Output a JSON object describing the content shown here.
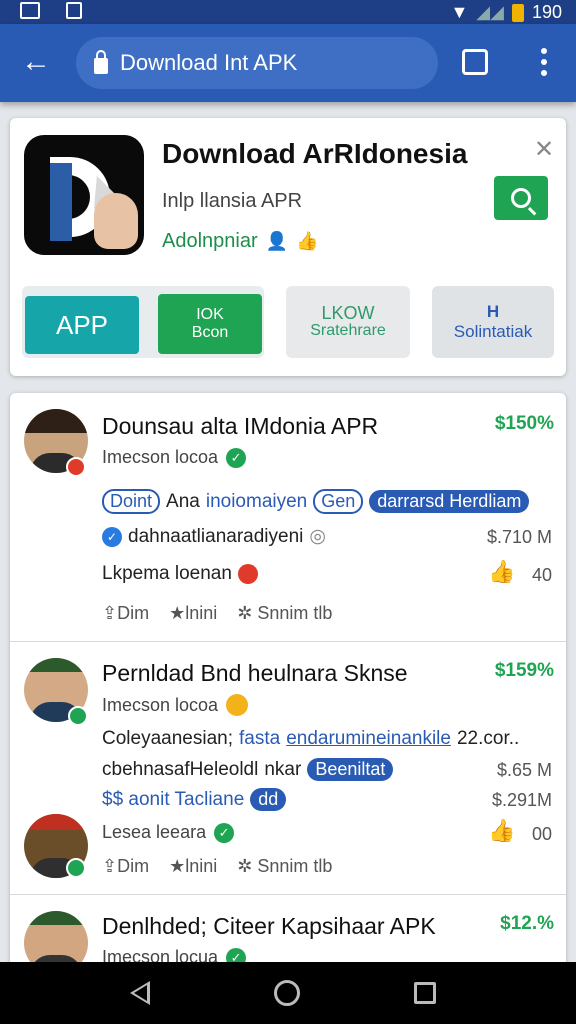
{
  "status_bar": {
    "time": "190",
    "icons": [
      "image-icon",
      "file-icon",
      "wifi-icon",
      "signal-icon",
      "battery-icon"
    ],
    "battery_color": "#f0b400"
  },
  "browser": {
    "url": "Download Int APK",
    "back_icon": "back-arrow-icon",
    "tabs_icon": "tabs-icon",
    "menu_icon": "more-vert-icon"
  },
  "hero": {
    "title": "Download ArRIdonesia",
    "subtitle": "Inlp llansia APR",
    "developer": "Adolnpniar",
    "buttons": {
      "app": "APP",
      "iok_line1": "IOK",
      "iok_line2": "Bcon",
      "lkow_line1": "LKOW",
      "lkow_line2": "Sratehrare",
      "sol_icon": "H",
      "sol_label": "Solintatiak"
    }
  },
  "items": [
    {
      "title": "Dounsau alta IMdonia APR",
      "price": "$150%",
      "meta": "Imecson locoa",
      "desc_tag": "Doint",
      "desc_mid": "Ana",
      "desc_link": "inoiomaiyen",
      "desc_tag2": "Gen",
      "desc_fill": "darrarsd Herdliam",
      "line2": "dahnaatlianaradiyeni",
      "line2_right": "$.710 M",
      "line3": "Lkpema loenan",
      "line3_right": "40",
      "actions": [
        "Dim",
        "lnini",
        "Snnim tlb"
      ]
    },
    {
      "title": "Pernldad Bnd heulnara Sknse",
      "price": "$159%",
      "meta": "Imecson locoa",
      "line1": "Coleyaanesian;",
      "line1_link": "fasta",
      "line1_link2": "endarumineinankile",
      "line1_end": "22.cor..",
      "line2": "cbehnasafHeleoldl",
      "line2_mid": "nkar",
      "line2_fill": "Beeniltat",
      "line2_right": "$.65 M",
      "line3": "$$ aonit Tacliane",
      "line3_fill": "dd",
      "line3_right": "$.291M",
      "sub_meta": "Lesea leeara",
      "sub_right": "00",
      "actions": [
        "Dim",
        "lnini",
        "Snnim tlb"
      ]
    },
    {
      "title": "Denlhded; Citeer Kapsihaar APK",
      "price": "$12.%",
      "meta": "Imecson locua"
    }
  ]
}
